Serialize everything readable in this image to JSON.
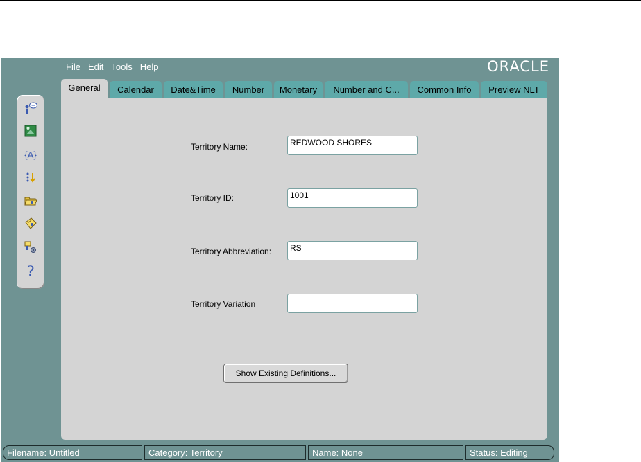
{
  "menu": [
    {
      "mnemonic": "F",
      "rest": "ile"
    },
    {
      "mnemonic": "",
      "rest": "Edit"
    },
    {
      "mnemonic": "T",
      "rest": "ools"
    },
    {
      "mnemonic": "H",
      "rest": "elp"
    }
  ],
  "brand": {
    "logo_text": "ORACLE"
  },
  "toolbar_icons": [
    "user-info-icon",
    "image-icon",
    "braces-icon",
    "sort-icon",
    "open-folder-icon",
    "save-icon",
    "settings-icon",
    "help-icon"
  ],
  "toolbar_braces_text": "{A}",
  "toolbar_help_text": "?",
  "tabs": [
    "General",
    "Calendar",
    "Date&Time",
    "Number",
    "Monetary",
    "Number and C...",
    "Common Info",
    "Preview NLT"
  ],
  "active_tab": "General",
  "form": {
    "territory_name_label": "Territory Name:",
    "territory_name_value": "REDWOOD SHORES",
    "territory_id_label": "Territory ID:",
    "territory_id_value": "1001",
    "territory_abbrev_label": "Territory Abbreviation:",
    "territory_abbrev_value": "RS",
    "territory_variation_label": "Territory Variation",
    "territory_variation_value": "",
    "show_button": "Show Existing Definitions..."
  },
  "status": {
    "filename": "Filename: Untitled",
    "category": "Category: Territory",
    "name": "Name: None",
    "state": "Status: Editing"
  },
  "colors": {
    "frame": "#6f9393",
    "tab": "#5ea9a9",
    "panel": "#d4d4d4"
  }
}
